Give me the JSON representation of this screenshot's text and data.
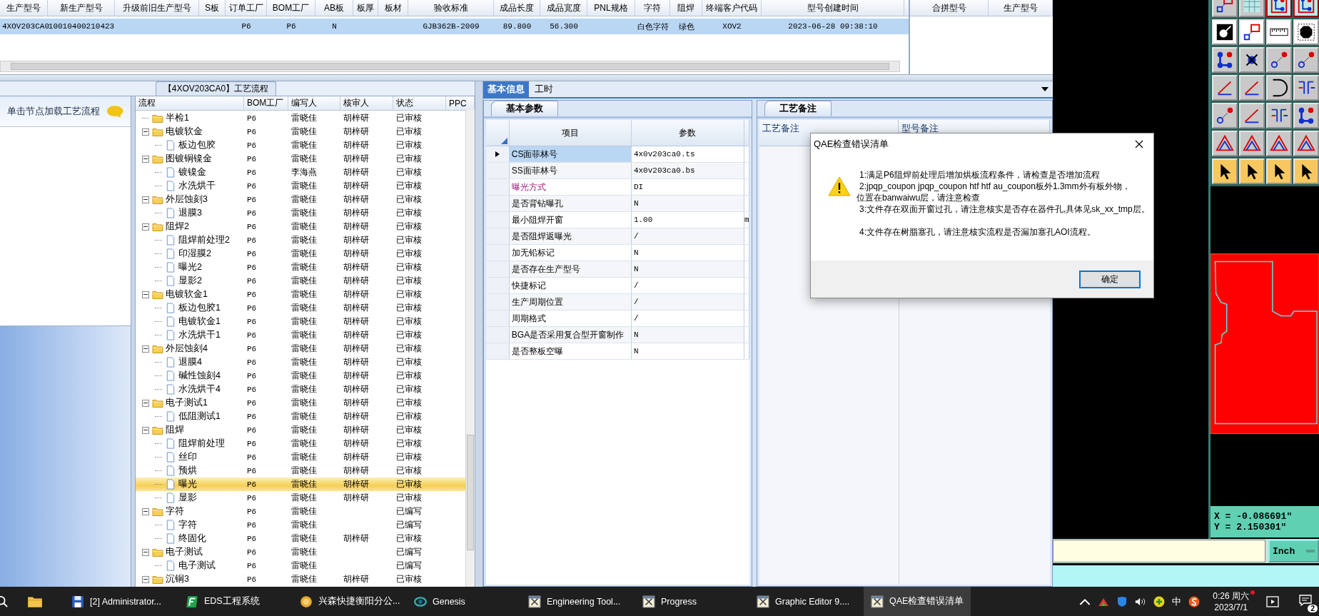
{
  "records_table": {
    "columns": [
      "生产型号",
      "新生产型号",
      "升级前旧生产型号",
      "S板",
      "订单工厂",
      "BOM工厂",
      "AB板",
      "板厚",
      "板材",
      "验收标准",
      "成品长度",
      "成品宽度",
      "PNL规格",
      "字符",
      "阻焊",
      "终端客户代码",
      "型号创建时间"
    ],
    "rows": [
      {
        "selected": true,
        "cells": [
          "4XOV203CA0",
          "10010400210423",
          null,
          null,
          "P6",
          "P6",
          "N",
          null,
          null,
          "GJB362B-2009",
          "89.800",
          "56.300",
          null,
          "白色字符",
          "绿色",
          "XOV2",
          "2023-06-28 09:38:10"
        ]
      }
    ]
  },
  "merge_table": {
    "columns": [
      "合拼型号",
      "生产型号"
    ]
  },
  "flow_panel": {
    "title": "【4XOV203CA0】工艺流程",
    "hint": "单击节点加载工艺流程"
  },
  "flow_tree": {
    "columns": [
      "流程",
      "BOM工厂",
      "编写人",
      "核审人",
      "状态",
      "PPC"
    ],
    "items": [
      {
        "label": "半检1",
        "kind": "folder",
        "selected": false,
        "bom": "P6",
        "writer": "雷晓佳",
        "reviewer": "胡梓研",
        "status": "已审核"
      },
      {
        "label": "电镀软金",
        "kind": "folder",
        "selected": false,
        "expanded": true,
        "bom": "P6",
        "writer": "雷晓佳",
        "reviewer": "胡梓研",
        "status": "已审核",
        "children": [
          {
            "label": "板边包胶",
            "kind": "step",
            "selected": false,
            "bom": "P6",
            "writer": "雷晓佳",
            "reviewer": "胡梓研",
            "status": "已审核"
          }
        ]
      },
      {
        "label": "图镀铜镍金",
        "kind": "folder",
        "selected": false,
        "expanded": true,
        "bom": "P6",
        "writer": "雷晓佳",
        "reviewer": "胡梓研",
        "status": "已审核",
        "children": [
          {
            "label": "镀镍金",
            "kind": "step",
            "selected": false,
            "bom": "P6",
            "writer": "李海燕",
            "reviewer": "胡梓研",
            "status": "已审核"
          },
          {
            "label": "水洗烘干",
            "kind": "step",
            "selected": false,
            "bom": "P6",
            "writer": "雷晓佳",
            "reviewer": "胡梓研",
            "status": "已审核"
          }
        ]
      },
      {
        "label": "外层蚀刻3",
        "kind": "folder",
        "selected": false,
        "expanded": true,
        "bom": "P6",
        "writer": "雷晓佳",
        "reviewer": "胡梓研",
        "status": "已审核",
        "children": [
          {
            "label": "退膜3",
            "kind": "step",
            "selected": false,
            "bom": "P6",
            "writer": "雷晓佳",
            "reviewer": "胡梓研",
            "status": "已审核"
          }
        ]
      },
      {
        "label": "阻焊2",
        "kind": "folder",
        "selected": false,
        "expanded": true,
        "bom": "P6",
        "writer": "雷晓佳",
        "reviewer": "胡梓研",
        "status": "已审核",
        "children": [
          {
            "label": "阻焊前处理2",
            "kind": "step",
            "selected": false,
            "bom": "P6",
            "writer": "雷晓佳",
            "reviewer": "胡梓研",
            "status": "已审核"
          },
          {
            "label": "印湿膜2",
            "kind": "step",
            "selected": false,
            "bom": "P6",
            "writer": "雷晓佳",
            "reviewer": "胡梓研",
            "status": "已审核"
          },
          {
            "label": "曝光2",
            "kind": "step",
            "selected": false,
            "bom": "P6",
            "writer": "雷晓佳",
            "reviewer": "胡梓研",
            "status": "已审核"
          },
          {
            "label": "显影2",
            "kind": "step",
            "selected": false,
            "bom": "P6",
            "writer": "雷晓佳",
            "reviewer": "胡梓研",
            "status": "已审核"
          }
        ]
      },
      {
        "label": "电镀软金1",
        "kind": "folder",
        "selected": false,
        "expanded": true,
        "bom": "P6",
        "writer": "雷晓佳",
        "reviewer": "胡梓研",
        "status": "已审核",
        "children": [
          {
            "label": "板边包胶1",
            "kind": "step",
            "selected": false,
            "bom": "P6",
            "writer": "雷晓佳",
            "reviewer": "胡梓研",
            "status": "已审核"
          },
          {
            "label": "电镀软金1",
            "kind": "step",
            "selected": false,
            "bom": "P6",
            "writer": "雷晓佳",
            "reviewer": "胡梓研",
            "status": "已审核"
          },
          {
            "label": "水洗烘干1",
            "kind": "step",
            "selected": false,
            "bom": "P6",
            "writer": "雷晓佳",
            "reviewer": "胡梓研",
            "status": "已审核"
          }
        ]
      },
      {
        "label": "外层蚀刻4",
        "kind": "folder",
        "selected": false,
        "expanded": true,
        "bom": "P6",
        "writer": "雷晓佳",
        "reviewer": "胡梓研",
        "status": "已审核",
        "children": [
          {
            "label": "退膜4",
            "kind": "step",
            "selected": false,
            "bom": "P6",
            "writer": "雷晓佳",
            "reviewer": "胡梓研",
            "status": "已审核"
          },
          {
            "label": "碱性蚀刻4",
            "kind": "step",
            "selected": false,
            "bom": "P6",
            "writer": "雷晓佳",
            "reviewer": "胡梓研",
            "status": "已审核"
          },
          {
            "label": "水洗烘干4",
            "kind": "step",
            "selected": false,
            "bom": "P6",
            "writer": "雷晓佳",
            "reviewer": "胡梓研",
            "status": "已审核"
          }
        ]
      },
      {
        "label": "电子测试1",
        "kind": "folder",
        "selected": false,
        "expanded": true,
        "bom": "P6",
        "writer": "雷晓佳",
        "reviewer": "胡梓研",
        "status": "已审核",
        "children": [
          {
            "label": "低阻测试1",
            "kind": "step",
            "selected": false,
            "bom": "P6",
            "writer": "雷晓佳",
            "reviewer": "胡梓研",
            "status": "已审核"
          }
        ]
      },
      {
        "label": "阻焊",
        "kind": "folder",
        "selected": false,
        "expanded": true,
        "bom": "P6",
        "writer": "雷晓佳",
        "reviewer": "胡梓研",
        "status": "已审核",
        "children": [
          {
            "label": "阻焊前处理",
            "kind": "step",
            "selected": false,
            "bom": "P6",
            "writer": "雷晓佳",
            "reviewer": "胡梓研",
            "status": "已审核"
          },
          {
            "label": "丝印",
            "kind": "step",
            "selected": false,
            "bom": "P6",
            "writer": "雷晓佳",
            "reviewer": "胡梓研",
            "status": "已审核"
          },
          {
            "label": "预烘",
            "kind": "step",
            "selected": false,
            "bom": "P6",
            "writer": "雷晓佳",
            "reviewer": "胡梓研",
            "status": "已审核"
          },
          {
            "label": "曝光",
            "kind": "step",
            "selected": true,
            "bom": "P6",
            "writer": "雷晓佳",
            "reviewer": "胡梓研",
            "status": "已审核"
          },
          {
            "label": "显影",
            "kind": "step",
            "selected": false,
            "bom": "P6",
            "writer": "雷晓佳",
            "reviewer": "胡梓研",
            "status": "已审核"
          }
        ]
      },
      {
        "label": "字符",
        "kind": "folder",
        "selected": false,
        "expanded": true,
        "bom": "P6",
        "writer": "雷晓佳",
        "status": "已编写",
        "children": [
          {
            "label": "字符",
            "kind": "step",
            "selected": false,
            "bom": "P6",
            "writer": "雷晓佳",
            "status": "已编写"
          },
          {
            "label": "终固化",
            "kind": "step",
            "selected": false,
            "bom": "P6",
            "writer": "雷晓佳",
            "reviewer": "胡梓研",
            "status": "已审核"
          }
        ]
      },
      {
        "label": "电子测试",
        "kind": "folder",
        "selected": false,
        "expanded": true,
        "bom": "P6",
        "writer": "雷晓佳",
        "status": "已编写",
        "children": [
          {
            "label": "电子测试",
            "kind": "step",
            "selected": false,
            "bom": "P6",
            "writer": "雷晓佳",
            "status": "已编写"
          }
        ]
      },
      {
        "label": "沉铜3",
        "kind": "folder",
        "selected": false,
        "expanded": true,
        "bom": "P6",
        "writer": "雷晓佳",
        "reviewer": "胡梓研",
        "status": "已审核"
      }
    ]
  },
  "detail_tabs": [
    {
      "label": "基本信息",
      "selected": true
    },
    {
      "label": "工时",
      "selected": false
    }
  ],
  "params_panel": {
    "tab": "基本参数",
    "columns": [
      "项目",
      "参数"
    ],
    "rows": [
      {
        "item": "CS面菲林号",
        "value": "4x0v203ca0.ts",
        "selected": true,
        "highlighted": false
      },
      {
        "item": "SS面菲林号",
        "value": "4x0v203ca0.bs",
        "selected": false,
        "highlighted": false
      },
      {
        "item": "曝光方式",
        "value": "DI",
        "selected": false,
        "highlighted": true
      },
      {
        "item": "是否背钻曝孔",
        "value": "N",
        "selected": false,
        "highlighted": false
      },
      {
        "item": "最小阻焊开窗",
        "value": "1.00",
        "column_3": "m",
        "selected": false,
        "highlighted": false
      },
      {
        "item": "是否阻焊返曝光",
        "value": "/",
        "selected": false,
        "highlighted": false
      },
      {
        "item": "加无铅标记",
        "value": "N",
        "selected": false,
        "highlighted": false
      },
      {
        "item": "是否存在生产型号",
        "value": "N",
        "selected": false,
        "highlighted": false
      },
      {
        "item": "快捷标记",
        "value": "/",
        "selected": false,
        "highlighted": false
      },
      {
        "item": "生产周期位置",
        "value": "/",
        "selected": false,
        "highlighted": false
      },
      {
        "item": "周期格式",
        "value": "/",
        "selected": false,
        "highlighted": false
      },
      {
        "item": "BGA是否采用复合型开窗制作",
        "value": "N",
        "selected": false,
        "highlighted": false
      },
      {
        "item": "是否整板空曝",
        "value": "N",
        "selected": false,
        "highlighted": false
      }
    ]
  },
  "notes_panel": {
    "tab": "工艺备注",
    "columns": [
      "工艺备注",
      "型号备注"
    ]
  },
  "dialog": {
    "title": "QAE检查错误清单",
    "messages": [
      {
        "text": "1:满足P6阻焊前处理后增加烘板流程条件，请检查是否增加流程",
        "indented": true
      },
      {
        "text": "2:jpqp_coupon jpqp_coupon htf htf au_coupon板外1.3mm外有板外物，",
        "indented": true
      },
      {
        "text": "位置在banwaiwu层，请注意检查",
        "indented": false
      },
      {
        "text": "3:文件存在双面开窗过孔，请注意核实是否存在器件孔,具体见sk_xx_tmp层。",
        "indented": true
      },
      {
        "text": "4:文件存在树脂塞孔，请注意核实流程是否漏加塞孔AOI流程。",
        "indented": true
      }
    ],
    "button": "确定"
  },
  "graphic_editor": {
    "x_readout": "X = -0.086691\"",
    "y_readout": "Y = 2.150301\"",
    "unit": "Inch"
  },
  "taskbar": {
    "items": [
      {
        "label": "[2] Administrator...",
        "selected": false
      },
      {
        "label": "EDS工程系统",
        "selected": false
      },
      {
        "label": "兴森快捷衡阳分公...",
        "selected": false
      },
      {
        "label": "Genesis",
        "selected": false
      },
      {
        "label": "Engineering Tool...",
        "selected": false
      },
      {
        "label": "Progress",
        "selected": false
      },
      {
        "label": "Graphic Editor 9....",
        "selected": false
      },
      {
        "label": "QAE检查错误清单",
        "selected": true
      }
    ],
    "input_method": "中",
    "time": "0:26 周六",
    "date": "2023/7/1",
    "notification_count": "2"
  }
}
